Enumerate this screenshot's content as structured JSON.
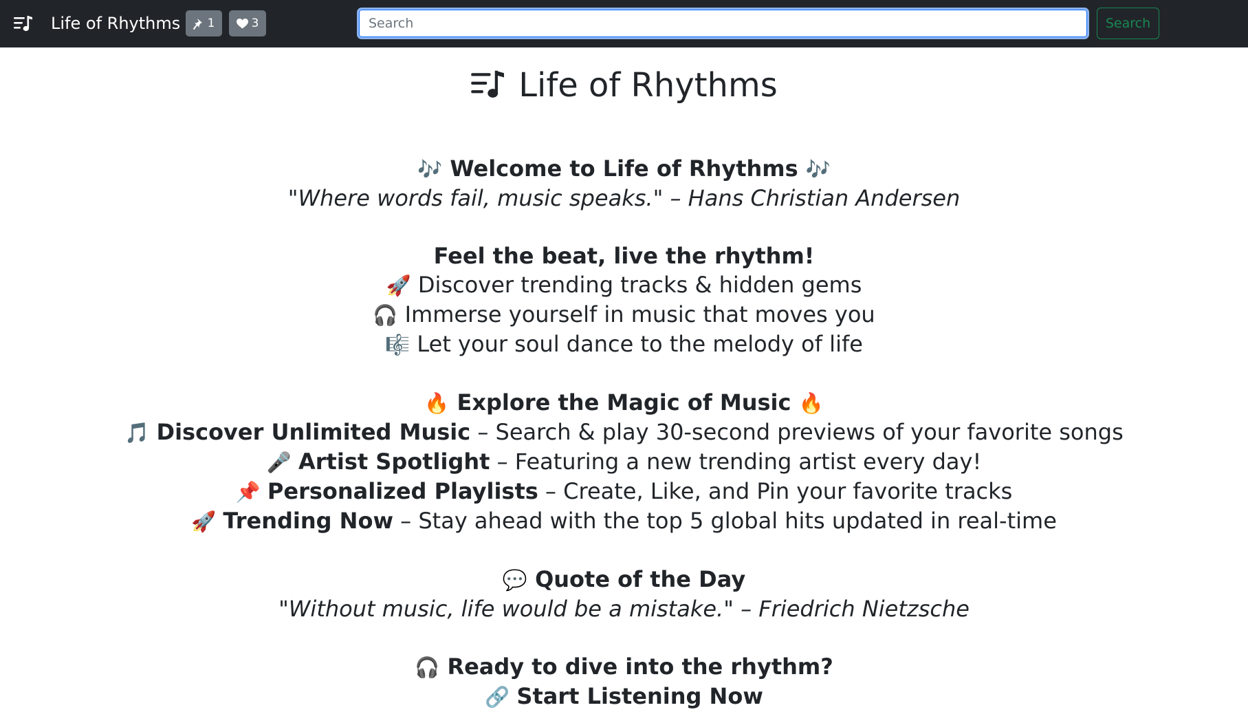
{
  "navbar": {
    "brand": "Life of Rhythms",
    "pin_count": "1",
    "like_count": "3",
    "search_placeholder": "Search",
    "search_button": "Search"
  },
  "page_title": "Life of Rhythms",
  "welcome": {
    "emoji": "🎶",
    "heading": "Welcome to Life of Rhythms",
    "quote": "\"Where words fail, music speaks.\" – Hans Christian Andersen"
  },
  "tagline": {
    "heading": "Feel the beat, live the rhythm!",
    "items": [
      {
        "emoji": "🚀",
        "text": "Discover trending tracks & hidden gems"
      },
      {
        "emoji": "🎧",
        "text": "Immerse yourself in music that moves you"
      },
      {
        "emoji": "🎼",
        "text": "Let your soul dance to the melody of life"
      }
    ]
  },
  "explore": {
    "emoji": "🔥",
    "heading": "Explore the Magic of Music",
    "features": [
      {
        "emoji": "🎵",
        "title": "Discover Unlimited Music",
        "desc": "– Search & play 30-second previews of your favorite songs"
      },
      {
        "emoji": "🎤",
        "title": "Artist Spotlight",
        "desc": "– Featuring a new trending artist every day!"
      },
      {
        "emoji": "📌",
        "title": "Personalized Playlists",
        "desc": "– Create, Like, and Pin your favorite tracks"
      },
      {
        "emoji": "🚀",
        "title": "Trending Now",
        "desc": "– Stay ahead with the top 5 global hits updated in real-time"
      }
    ]
  },
  "quote_of_day": {
    "emoji": "💬",
    "heading": "Quote of the Day",
    "quote": "\"Without music, life would be a mistake.\" – Friedrich Nietzsche"
  },
  "cta": {
    "emoji": "🎧",
    "heading": "Ready to dive into the rhythm?",
    "link_emoji": "🔗",
    "link_text": "Start Listening Now"
  },
  "colors": {
    "navbar_bg": "#212529",
    "badge_bg": "#6c757d",
    "search_button": "#198754",
    "focus_ring": "#8bb3f0"
  },
  "icons": {
    "logo": "music-note-list-icon",
    "pin": "pin-icon",
    "like": "heart-icon"
  }
}
